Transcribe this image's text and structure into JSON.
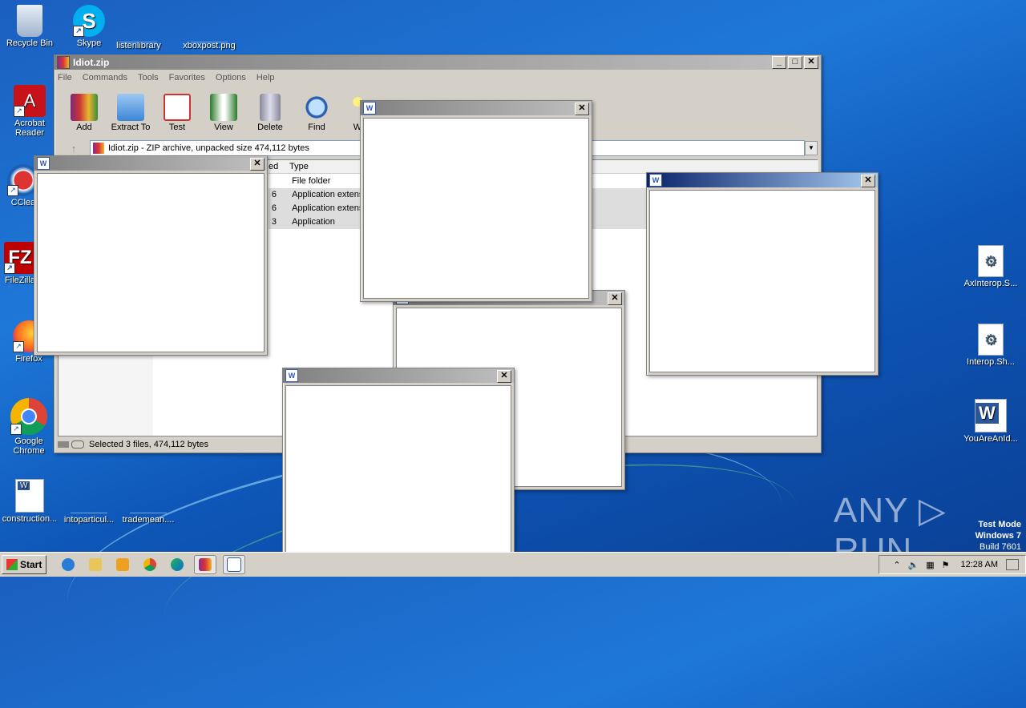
{
  "desktop": {
    "icons": [
      {
        "label": "Recycle Bin",
        "icon": "recycle-bin-icon"
      },
      {
        "label": "Skype",
        "icon": "skype-icon"
      },
      {
        "label": "listenlibrary",
        "icon": "file-icon"
      },
      {
        "label": "xboxpost.png",
        "icon": "image-file-icon"
      },
      {
        "label": "Acrobat Reader",
        "icon": "acrobat-icon"
      },
      {
        "label": "CClea",
        "icon": "ccleaner-icon"
      },
      {
        "label": "FileZilla",
        "icon": "filezilla-icon"
      },
      {
        "label": "Firefox",
        "icon": "firefox-icon"
      },
      {
        "label": "Google Chrome",
        "icon": "chrome-icon"
      },
      {
        "label": "construction...",
        "icon": "word-doc-icon"
      },
      {
        "label": "intoparticul...",
        "icon": "file-icon"
      },
      {
        "label": "trademean....",
        "icon": "file-icon"
      },
      {
        "label": "AxInterop.S...",
        "icon": "dll-icon"
      },
      {
        "label": "Interop.Sh...",
        "icon": "dll-icon"
      },
      {
        "label": "YouAreAnId...",
        "icon": "word-icon"
      }
    ]
  },
  "winrar": {
    "title": "Idiot.zip",
    "menu": [
      "File",
      "Commands",
      "Tools",
      "Favorites",
      "Options",
      "Help"
    ],
    "toolbar": [
      "Add",
      "Extract To",
      "Test",
      "View",
      "Delete",
      "Find",
      "Wiza"
    ],
    "address": "Idiot.zip - ZIP archive, unpacked size 474,112 bytes",
    "columns": {
      "partial": "ed",
      "type": "Type"
    },
    "rows": [
      {
        "size_tail": "",
        "type": "File folder"
      },
      {
        "size_tail": "6",
        "type": "Application extensio"
      },
      {
        "size_tail": "6",
        "type": "Application extensio"
      },
      {
        "size_tail": "3",
        "type": "Application"
      }
    ],
    "status": "Selected 3 files, 474,112 bytes"
  },
  "popups": {
    "close_glyph": "✕",
    "icon_letter": "W"
  },
  "taskbar": {
    "start_label": "Start",
    "clock": "12:28 AM"
  },
  "watermark": {
    "text": "ANY ▷ RUN"
  },
  "test_mode": {
    "line1": "Test Mode",
    "line2": "Windows 7",
    "line3": "Build 7601"
  }
}
